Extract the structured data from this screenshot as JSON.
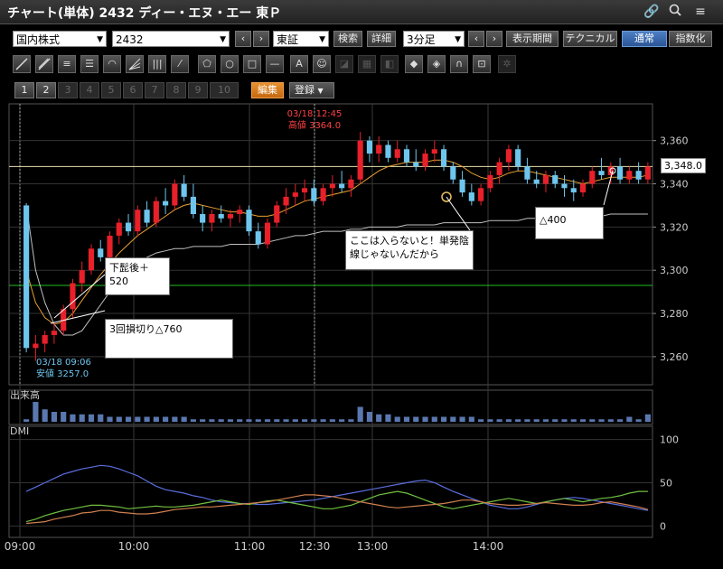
{
  "window": {
    "title": "チャート(単体) 2432 ディー・エヌ・エー 東Ｐ"
  },
  "toolbar1": {
    "market_select": "国内株式",
    "code_input": "2432",
    "exchange_select": "東証",
    "search_label": "検索",
    "detail_label": "詳細",
    "interval_select": "3分足",
    "display_period_label": "表示期間",
    "technical_label": "テクニカル",
    "normal_label": "通常",
    "index_label": "指数化",
    "prev": "‹",
    "next": "›"
  },
  "drawing_tools": [
    "line",
    "ray",
    "hlines",
    "channel",
    "arc",
    "fan",
    "vlines",
    "gann",
    "pentagon",
    "circle",
    "rect",
    "hline",
    "text",
    "icon",
    "t15",
    "t16",
    "t17",
    "t18",
    "t19",
    "t20",
    "t21",
    "t22"
  ],
  "pages": [
    "1",
    "2",
    "3",
    "4",
    "5",
    "6",
    "7",
    "8",
    "9",
    "10"
  ],
  "edit_label": "編集",
  "register_label": "登録",
  "chart_data": [
    {
      "type": "candlestick",
      "yticks": [
        3260,
        3280,
        3300,
        3320,
        3340,
        3360
      ],
      "ytick_labels": [
        "3,260",
        "3,280",
        "3,300",
        "3,320",
        "3,340",
        "3,360"
      ],
      "ylim": [
        3247,
        3377
      ],
      "xtick_labels": [
        "09:00",
        "10:00",
        "11:00",
        "12:30",
        "13:00",
        "14:00"
      ],
      "current_price_label": "3,348.0",
      "high_annotation": [
        "03/18 12:45",
        "高値 3364.0"
      ],
      "low_annotation": [
        "03/18 09:06",
        "安値 3257.0"
      ],
      "colors": {
        "up": "#e8202a",
        "down": "#6ec6ee",
        "ma_short": "#e8a030",
        "ma_long": "#c0c0c0",
        "hline": "#20c020"
      },
      "candles": [
        [
          3330,
          3331,
          3262,
          3264
        ],
        [
          3264,
          3270,
          3258,
          3266
        ],
        [
          3266,
          3272,
          3262,
          3270
        ],
        [
          3270,
          3276,
          3266,
          3272
        ],
        [
          3272,
          3284,
          3270,
          3282
        ],
        [
          3282,
          3296,
          3278,
          3294
        ],
        [
          3294,
          3304,
          3290,
          3300
        ],
        [
          3300,
          3312,
          3298,
          3310
        ],
        [
          3310,
          3314,
          3304,
          3306
        ],
        [
          3306,
          3318,
          3304,
          3316
        ],
        [
          3316,
          3324,
          3312,
          3322
        ],
        [
          3322,
          3326,
          3316,
          3318
        ],
        [
          3318,
          3330,
          3316,
          3328
        ],
        [
          3328,
          3332,
          3320,
          3322
        ],
        [
          3322,
          3334,
          3320,
          3332
        ],
        [
          3332,
          3338,
          3326,
          3330
        ],
        [
          3330,
          3342,
          3328,
          3340
        ],
        [
          3340,
          3344,
          3332,
          3334
        ],
        [
          3334,
          3340,
          3324,
          3326
        ],
        [
          3326,
          3330,
          3318,
          3322
        ],
        [
          3322,
          3328,
          3318,
          3326
        ],
        [
          3326,
          3330,
          3322,
          3324
        ],
        [
          3324,
          3328,
          3320,
          3326
        ],
        [
          3326,
          3330,
          3322,
          3328
        ],
        [
          3328,
          3330,
          3316,
          3318
        ],
        [
          3318,
          3322,
          3310,
          3312
        ],
        [
          3312,
          3324,
          3310,
          3322
        ],
        [
          3322,
          3332,
          3320,
          3330
        ],
        [
          3330,
          3338,
          3326,
          3334
        ],
        [
          3334,
          3340,
          3330,
          3336
        ],
        [
          3336,
          3342,
          3332,
          3338
        ],
        [
          3338,
          3342,
          3330,
          3332
        ],
        [
          3332,
          3340,
          3330,
          3338
        ],
        [
          3338,
          3344,
          3334,
          3340
        ],
        [
          3340,
          3346,
          3336,
          3338
        ],
        [
          3338,
          3344,
          3334,
          3342
        ],
        [
          3342,
          3364,
          3340,
          3360
        ],
        [
          3360,
          3362,
          3350,
          3354
        ],
        [
          3354,
          3362,
          3350,
          3358
        ],
        [
          3358,
          3360,
          3350,
          3352
        ],
        [
          3352,
          3360,
          3350,
          3356
        ],
        [
          3356,
          3358,
          3348,
          3350
        ],
        [
          3350,
          3356,
          3346,
          3348
        ],
        [
          3348,
          3356,
          3346,
          3354
        ],
        [
          3354,
          3360,
          3350,
          3356
        ],
        [
          3356,
          3358,
          3346,
          3348
        ],
        [
          3348,
          3350,
          3340,
          3342
        ],
        [
          3342,
          3346,
          3334,
          3336
        ],
        [
          3336,
          3340,
          3330,
          3332
        ],
        [
          3332,
          3340,
          3330,
          3338
        ],
        [
          3338,
          3346,
          3336,
          3344
        ],
        [
          3344,
          3352,
          3340,
          3350
        ],
        [
          3350,
          3358,
          3346,
          3356
        ],
        [
          3356,
          3358,
          3346,
          3348
        ],
        [
          3348,
          3352,
          3340,
          3342
        ],
        [
          3342,
          3346,
          3338,
          3340
        ],
        [
          3340,
          3346,
          3336,
          3344
        ],
        [
          3344,
          3346,
          3338,
          3340
        ],
        [
          3340,
          3344,
          3334,
          3338
        ],
        [
          3338,
          3342,
          3332,
          3336
        ],
        [
          3336,
          3342,
          3334,
          3340
        ],
        [
          3340,
          3348,
          3338,
          3346
        ],
        [
          3346,
          3352,
          3342,
          3344
        ],
        [
          3344,
          3350,
          3340,
          3348
        ],
        [
          3348,
          3352,
          3340,
          3342
        ],
        [
          3342,
          3348,
          3340,
          3346
        ],
        [
          3346,
          3350,
          3340,
          3342
        ],
        [
          3342,
          3350,
          3340,
          3348
        ]
      ],
      "ma_short": [
        3300,
        3285,
        3278,
        3275,
        3276,
        3280,
        3286,
        3292,
        3298,
        3303,
        3308,
        3312,
        3316,
        3319,
        3322,
        3325,
        3328,
        3330,
        3331,
        3330,
        3329,
        3328,
        3327,
        3327,
        3326,
        3325,
        3325,
        3326,
        3328,
        3330,
        3332,
        3333,
        3334,
        3335,
        3336,
        3337,
        3340,
        3343,
        3346,
        3348,
        3349,
        3350,
        3350,
        3350,
        3351,
        3351,
        3350,
        3348,
        3345,
        3343,
        3342,
        3343,
        3345,
        3346,
        3346,
        3345,
        3344,
        3343,
        3342,
        3341,
        3340,
        3341,
        3342,
        3343,
        3343,
        3343,
        3343,
        3344
      ],
      "ma_long": [
        3330,
        3300,
        3285,
        3275,
        3270,
        3270,
        3272,
        3278,
        3284,
        3290,
        3296,
        3300,
        3304,
        3306,
        3308,
        3309,
        3310,
        3310,
        3311,
        3311,
        3311,
        3311,
        3312,
        3312,
        3312,
        3312,
        3313,
        3314,
        3315,
        3316,
        3316,
        3317,
        3318,
        3318,
        3318,
        3319,
        3319,
        3320,
        3320,
        3320,
        3320,
        3321,
        3321,
        3321,
        3321,
        3322,
        3322,
        3322,
        3322,
        3322,
        3323,
        3323,
        3323,
        3323,
        3324,
        3324,
        3324,
        3324,
        3325,
        3325,
        3325,
        3325,
        3325,
        3326,
        3326,
        3326,
        3326,
        3326
      ],
      "hline_values": [
        3348,
        3293
      ]
    },
    {
      "type": "bar",
      "title": "出来高",
      "values": [
        1,
        8,
        5,
        4,
        4,
        3,
        3,
        3,
        3,
        2,
        2,
        2,
        2,
        2,
        2,
        2,
        2,
        2,
        1,
        1,
        1,
        1,
        1,
        1,
        1,
        1,
        1,
        1,
        1,
        1,
        1,
        1,
        1,
        1,
        1,
        1,
        6,
        4,
        3,
        3,
        2,
        2,
        2,
        2,
        2,
        2,
        2,
        2,
        2,
        1,
        1,
        1,
        1,
        1,
        1,
        1,
        1,
        1,
        1,
        1,
        1,
        1,
        1,
        1,
        1,
        2,
        1,
        3
      ]
    },
    {
      "type": "line",
      "title": "DMI",
      "yticks": [
        0,
        50,
        100
      ],
      "ylim": [
        -10,
        110
      ],
      "series": [
        {
          "color": "#5a6ee0",
          "values": [
            40,
            45,
            50,
            55,
            60,
            63,
            66,
            68,
            70,
            69,
            66,
            62,
            58,
            52,
            46,
            42,
            40,
            38,
            35,
            33,
            30,
            28,
            27,
            26,
            26,
            25,
            25,
            26,
            27,
            28,
            29,
            30,
            32,
            34,
            36,
            38,
            40,
            42,
            44,
            46,
            48,
            50,
            52,
            53,
            50,
            45,
            40,
            36,
            32,
            28,
            24,
            22,
            20,
            20,
            22,
            25,
            28,
            30,
            32,
            33,
            32,
            30,
            28,
            26,
            24,
            22,
            20,
            18
          ]
        },
        {
          "color": "#70c040",
          "values": [
            5,
            8,
            12,
            15,
            18,
            20,
            22,
            24,
            24,
            23,
            22,
            20,
            21,
            22,
            23,
            22,
            22,
            23,
            24,
            26,
            28,
            30,
            28,
            26,
            25,
            27,
            29,
            30,
            28,
            26,
            24,
            22,
            20,
            20,
            22,
            24,
            28,
            32,
            36,
            38,
            40,
            38,
            34,
            30,
            26,
            22,
            20,
            22,
            24,
            26,
            28,
            30,
            32,
            30,
            28,
            26,
            28,
            30,
            32,
            30,
            28,
            30,
            32,
            33,
            35,
            38,
            40,
            40
          ]
        },
        {
          "color": "#d08050",
          "values": [
            3,
            4,
            5,
            8,
            10,
            12,
            15,
            16,
            18,
            18,
            16,
            15,
            14,
            14,
            15,
            17,
            19,
            20,
            21,
            22,
            22,
            23,
            24,
            25,
            26,
            27,
            28,
            30,
            32,
            34,
            36,
            36,
            35,
            34,
            32,
            30,
            28,
            26,
            24,
            22,
            21,
            22,
            23,
            24,
            25,
            26,
            28,
            30,
            30,
            28,
            26,
            25,
            24,
            24,
            25,
            26,
            27,
            26,
            25,
            24,
            24,
            25,
            27,
            28,
            26,
            24,
            22,
            19
          ]
        }
      ]
    }
  ],
  "annotations": {
    "note1": "下髭後＋520",
    "note2": "3回損切り△760",
    "note3": "ここは入らないと！単発陰線じゃないんだから",
    "note4": "△400"
  }
}
